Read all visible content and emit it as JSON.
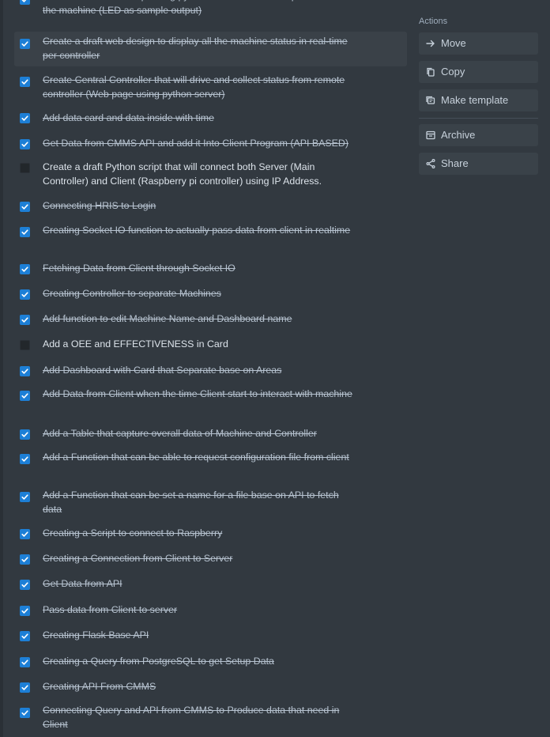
{
  "sidebar": {
    "actions_label": "Actions",
    "buttons": [
      {
        "label": "Move",
        "icon": "arrow-right-icon"
      },
      {
        "label": "Copy",
        "icon": "copy-icon"
      },
      {
        "label": "Make template",
        "icon": "template-icon"
      },
      {
        "label": "Archive",
        "icon": "archive-icon"
      },
      {
        "label": "Share",
        "icon": "share-icon"
      }
    ]
  },
  "colors": {
    "background": "#323940",
    "checkbox_checked": "#1d7fd6",
    "highlight_row": "#3a4148",
    "button_bg": "#3a4249"
  },
  "checklist": {
    "items": [
      {
        "text": "Create a controller script using python and use the GPIO port to control the machine (LED as sample output)",
        "checked": true
      },
      {
        "text": "Create a draft web design to display all the machine status in real-time per controller",
        "checked": true
      },
      {
        "text": "Create Central Controller that will drive and collect status from remote controller (Web page using python server)",
        "checked": true
      },
      {
        "text": "Add data card and data inside with time",
        "checked": true
      },
      {
        "text": "Get Data from CMMS API and add it Into Client Program (API BASED)",
        "checked": true
      },
      {
        "text": "Create a draft Python script that will connect both Server (Main Controller) and Client (Raspberry pi controller) using IP Address.",
        "checked": false
      },
      {
        "text": "Connecting HRIS to Login",
        "checked": true
      },
      {
        "text": "Creating Socket IO function to actually pass data from client in realtime",
        "checked": true
      },
      {
        "text": "Fetching Data from Client through Socket IO",
        "checked": true
      },
      {
        "text": "Creating Controller to separate Machines",
        "checked": true
      },
      {
        "text": "Add function to edit Machine Name and Dashboard name",
        "checked": true
      },
      {
        "text": "Add a OEE and EFFECTIVENESS in Card",
        "checked": false
      },
      {
        "text": "Add Dashboard with Card that Separate base on Areas",
        "checked": true
      },
      {
        "text": "Add Data from Client when the time Client start to interact with machine",
        "checked": true
      },
      {
        "text": "Add a Table that capture overall data of Machine and Controller",
        "checked": true
      },
      {
        "text": "Add a Function that can be able to request configuration file from client",
        "checked": true
      },
      {
        "text": "Add a Function that can be set a name for a file base on API to fetch data",
        "checked": true
      },
      {
        "text": "Creating a Script to connect to Raspberry",
        "checked": true
      },
      {
        "text": "Creating a Connection from Client to Server",
        "checked": true
      },
      {
        "text": "Get Data from API",
        "checked": true
      },
      {
        "text": "Pass data from Client to server",
        "checked": true
      },
      {
        "text": "Creating Flask Base API",
        "checked": true
      },
      {
        "text": "Creating a Query from PostgreSQL to get Setup Data",
        "checked": true
      },
      {
        "text": "Creating API From CMMS",
        "checked": true
      },
      {
        "text": "Connecting Query and API from CMMS to Produce data that need in Client",
        "checked": true
      }
    ]
  }
}
